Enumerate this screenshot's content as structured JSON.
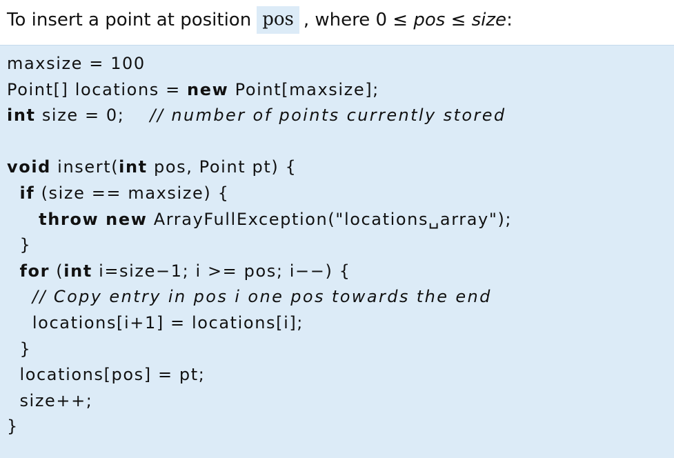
{
  "heading": {
    "prefix": "To insert a point at position",
    "pos_code": "pos",
    "middle": ", where 0 ≤",
    "pos_var": "pos",
    "leq": "≤",
    "size_var": "size",
    "suffix": ":"
  },
  "code": {
    "lines": [
      [
        {
          "t": "maxsize = 100",
          "s": "n"
        }
      ],
      [
        {
          "t": "Point[] locations = ",
          "s": "n"
        },
        {
          "t": "new",
          "s": "b"
        },
        {
          "t": " Point[maxsize];",
          "s": "n"
        }
      ],
      [
        {
          "t": "int",
          "s": "b"
        },
        {
          "t": " size = 0;    ",
          "s": "n"
        },
        {
          "t": "// number of points currently stored",
          "s": "i"
        }
      ],
      [],
      [
        {
          "t": "void",
          "s": "b"
        },
        {
          "t": " insert(",
          "s": "n"
        },
        {
          "t": "int",
          "s": "b"
        },
        {
          "t": " pos, Point pt) {",
          "s": "n"
        }
      ],
      [
        {
          "t": "  ",
          "s": "n"
        },
        {
          "t": "if",
          "s": "b"
        },
        {
          "t": " (size == maxsize) {",
          "s": "n"
        }
      ],
      [
        {
          "t": "     ",
          "s": "n"
        },
        {
          "t": "throw new",
          "s": "b"
        },
        {
          "t": " ArrayFullException(\"locations␣array\");",
          "s": "n"
        }
      ],
      [
        {
          "t": "  }",
          "s": "n"
        }
      ],
      [
        {
          "t": "  ",
          "s": "n"
        },
        {
          "t": "for",
          "s": "b"
        },
        {
          "t": " (",
          "s": "n"
        },
        {
          "t": "int",
          "s": "b"
        },
        {
          "t": " i=size−1; i >= pos; i−−) {",
          "s": "n"
        }
      ],
      [
        {
          "t": "    ",
          "s": "n"
        },
        {
          "t": "// Copy entry in pos i one pos towards the end",
          "s": "i"
        }
      ],
      [
        {
          "t": "    locations[i+1] = locations[i];",
          "s": "n"
        }
      ],
      [
        {
          "t": "  }",
          "s": "n"
        }
      ],
      [
        {
          "t": "  locations[pos] = pt;",
          "s": "n"
        }
      ],
      [
        {
          "t": "  size++;",
          "s": "n"
        }
      ],
      [
        {
          "t": "}",
          "s": "n"
        }
      ]
    ]
  },
  "colors": {
    "panel_background": "#dcebf7",
    "text": "#111111"
  }
}
